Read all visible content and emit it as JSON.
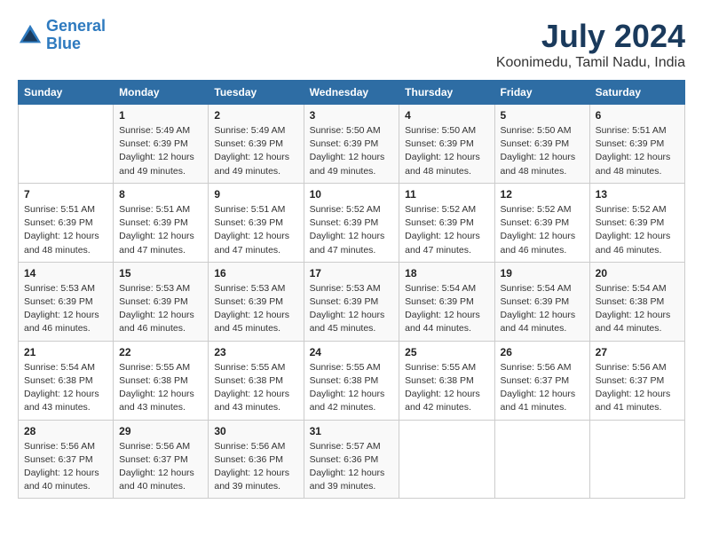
{
  "logo": {
    "line1": "General",
    "line2": "Blue"
  },
  "title": {
    "month_year": "July 2024",
    "location": "Koonimedu, Tamil Nadu, India"
  },
  "headers": [
    "Sunday",
    "Monday",
    "Tuesday",
    "Wednesday",
    "Thursday",
    "Friday",
    "Saturday"
  ],
  "weeks": [
    [
      {
        "day": "",
        "info": ""
      },
      {
        "day": "1",
        "info": "Sunrise: 5:49 AM\nSunset: 6:39 PM\nDaylight: 12 hours\nand 49 minutes."
      },
      {
        "day": "2",
        "info": "Sunrise: 5:49 AM\nSunset: 6:39 PM\nDaylight: 12 hours\nand 49 minutes."
      },
      {
        "day": "3",
        "info": "Sunrise: 5:50 AM\nSunset: 6:39 PM\nDaylight: 12 hours\nand 49 minutes."
      },
      {
        "day": "4",
        "info": "Sunrise: 5:50 AM\nSunset: 6:39 PM\nDaylight: 12 hours\nand 48 minutes."
      },
      {
        "day": "5",
        "info": "Sunrise: 5:50 AM\nSunset: 6:39 PM\nDaylight: 12 hours\nand 48 minutes."
      },
      {
        "day": "6",
        "info": "Sunrise: 5:51 AM\nSunset: 6:39 PM\nDaylight: 12 hours\nand 48 minutes."
      }
    ],
    [
      {
        "day": "7",
        "info": "Sunrise: 5:51 AM\nSunset: 6:39 PM\nDaylight: 12 hours\nand 48 minutes."
      },
      {
        "day": "8",
        "info": "Sunrise: 5:51 AM\nSunset: 6:39 PM\nDaylight: 12 hours\nand 47 minutes."
      },
      {
        "day": "9",
        "info": "Sunrise: 5:51 AM\nSunset: 6:39 PM\nDaylight: 12 hours\nand 47 minutes."
      },
      {
        "day": "10",
        "info": "Sunrise: 5:52 AM\nSunset: 6:39 PM\nDaylight: 12 hours\nand 47 minutes."
      },
      {
        "day": "11",
        "info": "Sunrise: 5:52 AM\nSunset: 6:39 PM\nDaylight: 12 hours\nand 47 minutes."
      },
      {
        "day": "12",
        "info": "Sunrise: 5:52 AM\nSunset: 6:39 PM\nDaylight: 12 hours\nand 46 minutes."
      },
      {
        "day": "13",
        "info": "Sunrise: 5:52 AM\nSunset: 6:39 PM\nDaylight: 12 hours\nand 46 minutes."
      }
    ],
    [
      {
        "day": "14",
        "info": "Sunrise: 5:53 AM\nSunset: 6:39 PM\nDaylight: 12 hours\nand 46 minutes."
      },
      {
        "day": "15",
        "info": "Sunrise: 5:53 AM\nSunset: 6:39 PM\nDaylight: 12 hours\nand 46 minutes."
      },
      {
        "day": "16",
        "info": "Sunrise: 5:53 AM\nSunset: 6:39 PM\nDaylight: 12 hours\nand 45 minutes."
      },
      {
        "day": "17",
        "info": "Sunrise: 5:53 AM\nSunset: 6:39 PM\nDaylight: 12 hours\nand 45 minutes."
      },
      {
        "day": "18",
        "info": "Sunrise: 5:54 AM\nSunset: 6:39 PM\nDaylight: 12 hours\nand 44 minutes."
      },
      {
        "day": "19",
        "info": "Sunrise: 5:54 AM\nSunset: 6:39 PM\nDaylight: 12 hours\nand 44 minutes."
      },
      {
        "day": "20",
        "info": "Sunrise: 5:54 AM\nSunset: 6:38 PM\nDaylight: 12 hours\nand 44 minutes."
      }
    ],
    [
      {
        "day": "21",
        "info": "Sunrise: 5:54 AM\nSunset: 6:38 PM\nDaylight: 12 hours\nand 43 minutes."
      },
      {
        "day": "22",
        "info": "Sunrise: 5:55 AM\nSunset: 6:38 PM\nDaylight: 12 hours\nand 43 minutes."
      },
      {
        "day": "23",
        "info": "Sunrise: 5:55 AM\nSunset: 6:38 PM\nDaylight: 12 hours\nand 43 minutes."
      },
      {
        "day": "24",
        "info": "Sunrise: 5:55 AM\nSunset: 6:38 PM\nDaylight: 12 hours\nand 42 minutes."
      },
      {
        "day": "25",
        "info": "Sunrise: 5:55 AM\nSunset: 6:38 PM\nDaylight: 12 hours\nand 42 minutes."
      },
      {
        "day": "26",
        "info": "Sunrise: 5:56 AM\nSunset: 6:37 PM\nDaylight: 12 hours\nand 41 minutes."
      },
      {
        "day": "27",
        "info": "Sunrise: 5:56 AM\nSunset: 6:37 PM\nDaylight: 12 hours\nand 41 minutes."
      }
    ],
    [
      {
        "day": "28",
        "info": "Sunrise: 5:56 AM\nSunset: 6:37 PM\nDaylight: 12 hours\nand 40 minutes."
      },
      {
        "day": "29",
        "info": "Sunrise: 5:56 AM\nSunset: 6:37 PM\nDaylight: 12 hours\nand 40 minutes."
      },
      {
        "day": "30",
        "info": "Sunrise: 5:56 AM\nSunset: 6:36 PM\nDaylight: 12 hours\nand 39 minutes."
      },
      {
        "day": "31",
        "info": "Sunrise: 5:57 AM\nSunset: 6:36 PM\nDaylight: 12 hours\nand 39 minutes."
      },
      {
        "day": "",
        "info": ""
      },
      {
        "day": "",
        "info": ""
      },
      {
        "day": "",
        "info": ""
      }
    ]
  ]
}
